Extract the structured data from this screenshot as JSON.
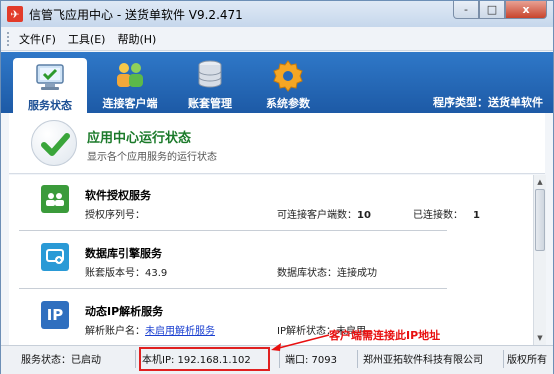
{
  "window": {
    "title": "信管飞应用中心 - 送货单软件 V9.2.471",
    "minimize_label": "-",
    "maximize_label": "□",
    "close_label": "x"
  },
  "menu": {
    "items": [
      {
        "label": "文件(F)"
      },
      {
        "label": "工具(E)"
      },
      {
        "label": "帮助(H)"
      }
    ]
  },
  "toolbar": {
    "tabs": [
      {
        "label": "服务状态",
        "icon": "monitor-check-icon",
        "active": true
      },
      {
        "label": "连接客户端",
        "icon": "users-icon",
        "active": false
      },
      {
        "label": "账套管理",
        "icon": "database-icon",
        "active": false
      },
      {
        "label": "系统参数",
        "icon": "gear-icon",
        "active": false
      }
    ],
    "program_type": "程序类型：送货单软件"
  },
  "header": {
    "title": "应用中心运行状态",
    "subtitle": "显示各个应用服务的运行状态"
  },
  "services": [
    {
      "name": "软件授权服务",
      "icon": "license-users-icon",
      "color": "#3b9b3b",
      "left_label": "授权序列号：",
      "left_value": "",
      "mid_label": "可连接客户端数：",
      "mid_value": "10",
      "right_label": "已连接数：",
      "right_value": "1"
    },
    {
      "name": "数据库引擎服务",
      "icon": "database-engine-icon",
      "color": "#2a9ad6",
      "left_label": "账套版本号：",
      "left_value": "43.9",
      "mid_label": "数据库状态：",
      "mid_value": "连接成功"
    },
    {
      "name": "动态IP解析服务",
      "icon": "ip-icon",
      "icon_text": "IP",
      "color": "#2f6fbf",
      "left_label": "解析账户名：",
      "left_value": "未启用解析服务",
      "mid_label": "IP解析状态：",
      "mid_value": "未启用"
    }
  ],
  "statusbar": {
    "service_status": "服务状态：已启动",
    "local_ip": "本机IP: 192.168.1.102",
    "port": "端口: 7093",
    "company": "郑州亚拓软件科技有限公司",
    "copyright": "版权所有"
  },
  "annotation": {
    "text": "客户端需连接此IP地址",
    "color": "#e81010"
  },
  "colors": {
    "toolbar_blue": "#2468b8",
    "header_green": "#1b7a2a",
    "link_blue": "#1a3fd0"
  }
}
